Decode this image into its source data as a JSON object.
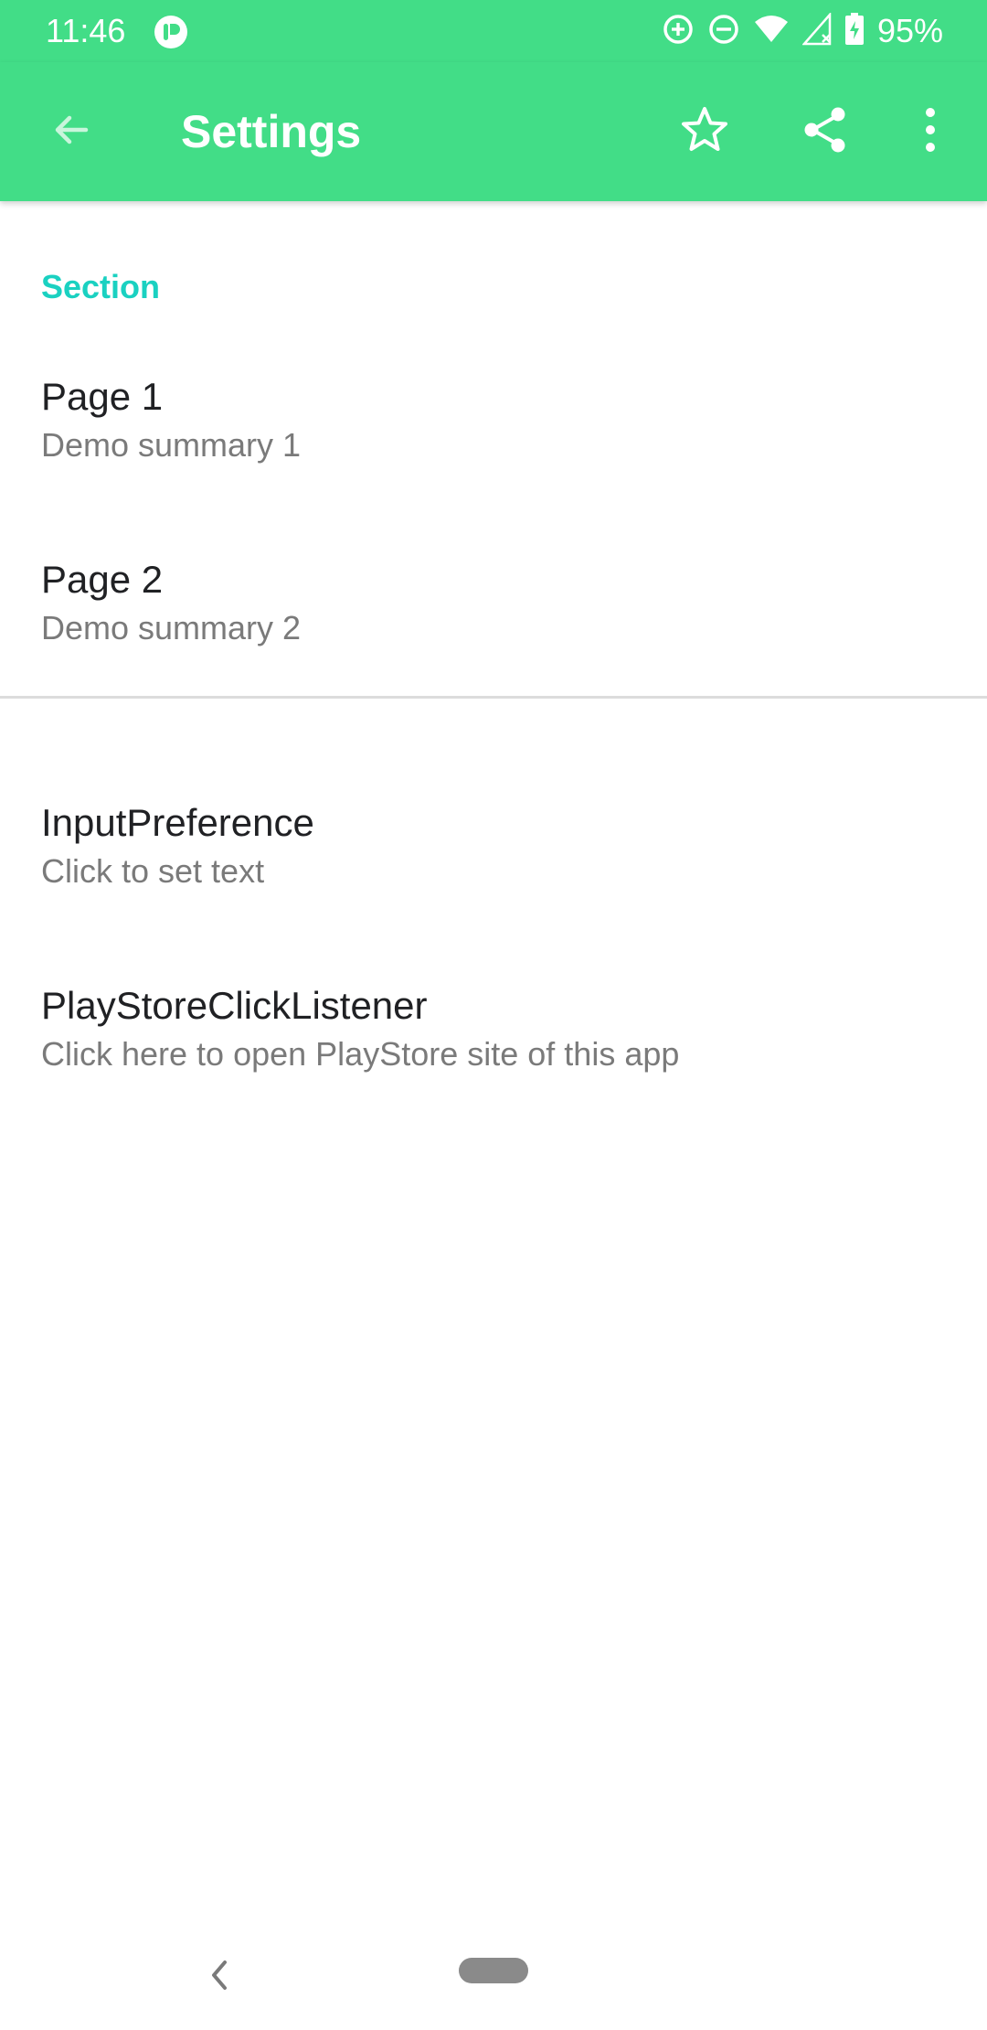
{
  "status_bar": {
    "time": "11:46",
    "battery_percent": "95%",
    "icons": [
      "app-notification-icon",
      "data-saver-icon",
      "do-not-disturb-icon",
      "wifi-icon",
      "signal-no-service-icon",
      "battery-charging-icon"
    ],
    "background_color": "#42dd87"
  },
  "app_bar": {
    "title": "Settings",
    "icons": [
      "back-arrow-icon",
      "star-icon",
      "share-icon",
      "more-vert-icon"
    ],
    "background_color": "#42dd87"
  },
  "accent_color": "#1ad1c1",
  "section": {
    "header": "Section",
    "items": [
      {
        "title": "Page 1",
        "summary": "Demo summary 1"
      },
      {
        "title": "Page 2",
        "summary": "Demo summary 2"
      }
    ]
  },
  "other_items": [
    {
      "title": "InputPreference",
      "summary": "Click to set text"
    },
    {
      "title": "PlayStoreClickListener",
      "summary": "Click here to open PlayStore site of this app"
    }
  ],
  "nav_bar": {
    "icons": [
      "nav-back-icon",
      "nav-home-pill-icon"
    ]
  }
}
